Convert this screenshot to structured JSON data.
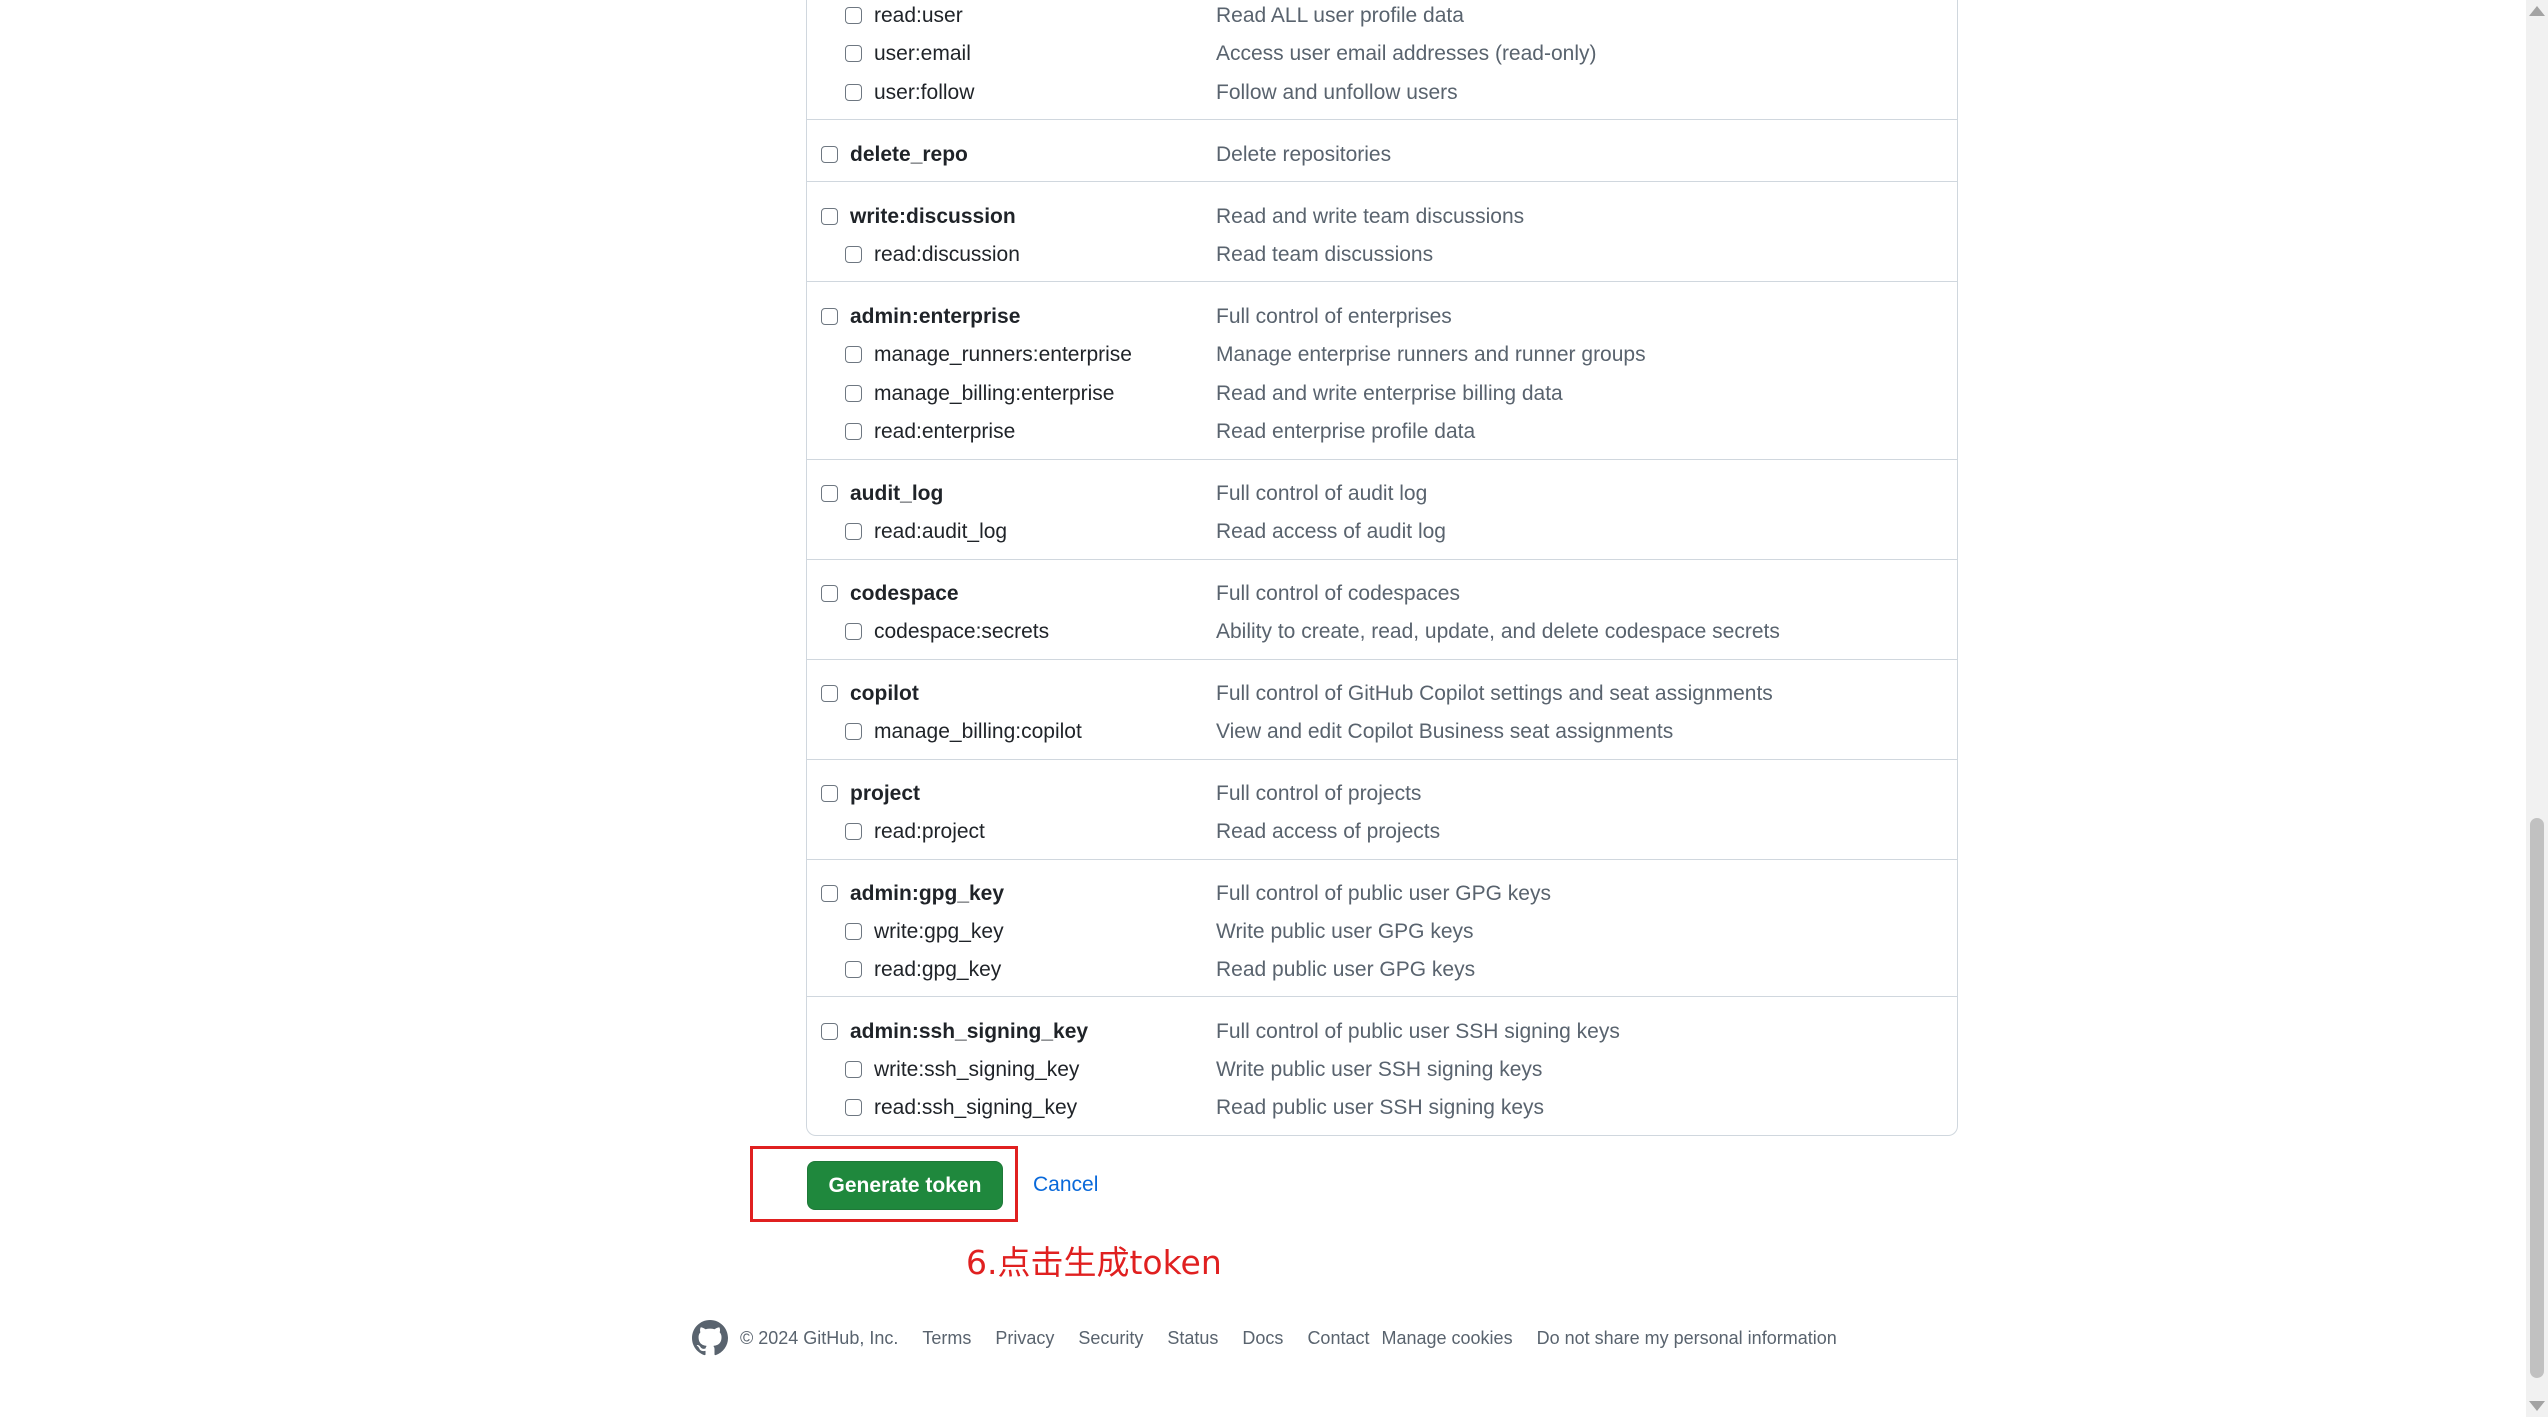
{
  "scopes": [
    {
      "name": "read:user",
      "desc": "Read ALL user profile data",
      "level": "child"
    },
    {
      "name": "user:email",
      "desc": "Access user email addresses (read-only)",
      "level": "child"
    },
    {
      "name": "user:follow",
      "desc": "Follow and unfollow users",
      "level": "child"
    },
    {
      "name": "delete_repo",
      "desc": "Delete repositories",
      "level": "parent"
    },
    {
      "name": "write:discussion",
      "desc": "Read and write team discussions",
      "level": "parent"
    },
    {
      "name": "read:discussion",
      "desc": "Read team discussions",
      "level": "child"
    },
    {
      "name": "admin:enterprise",
      "desc": "Full control of enterprises",
      "level": "parent"
    },
    {
      "name": "manage_runners:enterprise",
      "desc": "Manage enterprise runners and runner groups",
      "level": "child"
    },
    {
      "name": "manage_billing:enterprise",
      "desc": "Read and write enterprise billing data",
      "level": "child"
    },
    {
      "name": "read:enterprise",
      "desc": "Read enterprise profile data",
      "level": "child"
    },
    {
      "name": "audit_log",
      "desc": "Full control of audit log",
      "level": "parent"
    },
    {
      "name": "read:audit_log",
      "desc": "Read access of audit log",
      "level": "child"
    },
    {
      "name": "codespace",
      "desc": "Full control of codespaces",
      "level": "parent"
    },
    {
      "name": "codespace:secrets",
      "desc": "Ability to create, read, update, and delete codespace secrets",
      "level": "child"
    },
    {
      "name": "copilot",
      "desc": "Full control of GitHub Copilot settings and seat assignments",
      "level": "parent"
    },
    {
      "name": "manage_billing:copilot",
      "desc": "View and edit Copilot Business seat assignments",
      "level": "child"
    },
    {
      "name": "project",
      "desc": "Full control of projects",
      "level": "parent"
    },
    {
      "name": "read:project",
      "desc": "Read access of projects",
      "level": "child"
    },
    {
      "name": "admin:gpg_key",
      "desc": "Full control of public user GPG keys",
      "level": "parent"
    },
    {
      "name": "write:gpg_key",
      "desc": "Write public user GPG keys",
      "level": "child"
    },
    {
      "name": "read:gpg_key",
      "desc": "Read public user GPG keys",
      "level": "child"
    },
    {
      "name": "admin:ssh_signing_key",
      "desc": "Full control of public user SSH signing keys",
      "level": "parent"
    },
    {
      "name": "write:ssh_signing_key",
      "desc": "Write public user SSH signing keys",
      "level": "child"
    },
    {
      "name": "read:ssh_signing_key",
      "desc": "Read public user SSH signing keys",
      "level": "child"
    }
  ],
  "actions": {
    "generate_label": "Generate token",
    "cancel_label": "Cancel"
  },
  "annotation": "6.点击生成token",
  "footer": {
    "copyright": "© 2024 GitHub, Inc.",
    "links": [
      "Terms",
      "Privacy",
      "Security",
      "Status",
      "Docs",
      "Contact",
      "Manage cookies",
      "Do not share my personal information"
    ]
  },
  "colors": {
    "primary_button": "#1f883d",
    "link": "#0969da",
    "annotation_red": "#e02020",
    "border": "#d0d7de"
  },
  "icons": [
    "github-logo-icon",
    "checkbox-icon",
    "scroll-up-arrow-icon",
    "scroll-down-arrow-icon"
  ]
}
